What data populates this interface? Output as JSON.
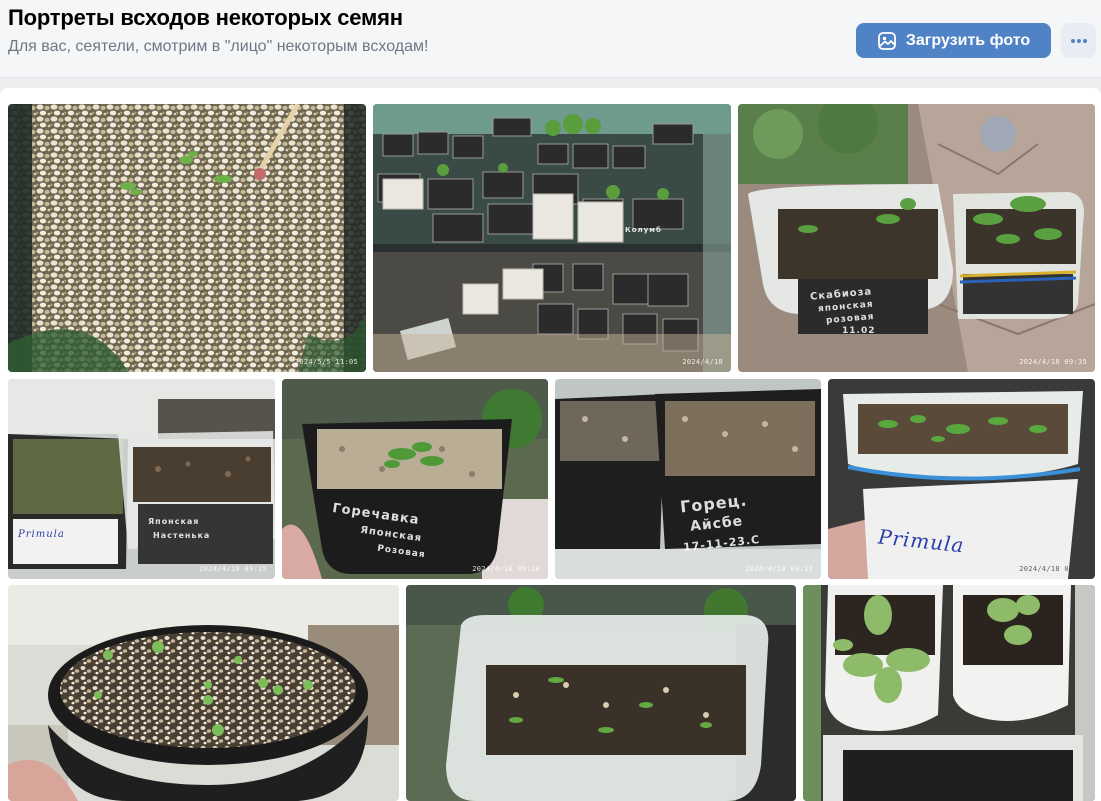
{
  "album": {
    "title": "Портреты всходов некоторых семян",
    "description": "Для вас, сеятели, смотрим в \"лицо\" некоторым всходам!"
  },
  "actions": {
    "upload_label": "Загрузить фото",
    "upload_icon": "image-icon",
    "more_icon": "more-dots-icon"
  },
  "colors": {
    "accent": "#4f83c5",
    "page_bg": "#edeef0",
    "secondary_text": "#6d7885"
  },
  "photos": [
    {
      "stamp": "2024/5/5 11:05",
      "labels": []
    },
    {
      "stamp": "2024/4/18",
      "labels": [
        "Колумб"
      ]
    },
    {
      "stamp": "2024/4/18 09:35",
      "labels": [
        "Скабиоза",
        "японская",
        "розовая",
        "11.02"
      ]
    },
    {
      "stamp": "2024/4/18 09:25",
      "labels": [
        "Primula",
        "Японская",
        "Настенька"
      ]
    },
    {
      "stamp": "2024/4/18 09:20",
      "labels": [
        "Горечавка",
        "Японская",
        "Розовая"
      ]
    },
    {
      "stamp": "2024/4/18 09:13",
      "labels": [
        "Горец.",
        "Айсбе",
        "17-11-23.С"
      ]
    },
    {
      "stamp": "2024/4/18 09:02",
      "labels": [
        "Primula"
      ]
    },
    {
      "stamp": "",
      "labels": []
    },
    {
      "stamp": "",
      "labels": []
    },
    {
      "stamp": "",
      "labels": []
    }
  ]
}
